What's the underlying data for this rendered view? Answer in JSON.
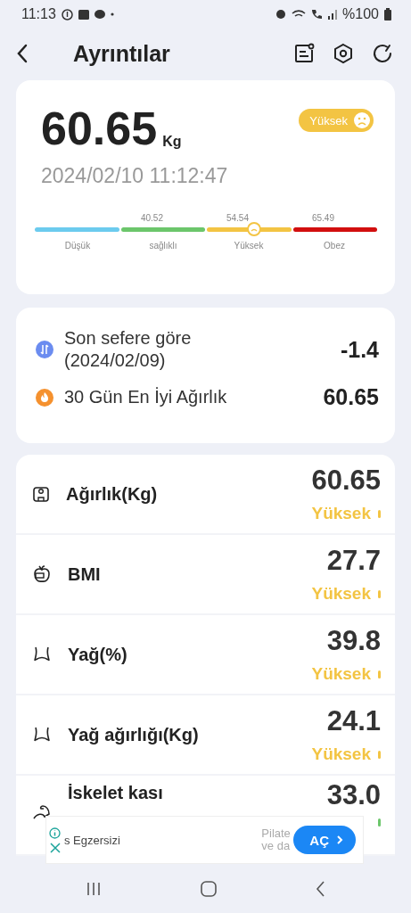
{
  "status_bar": {
    "time": "11:13",
    "battery": "%100"
  },
  "header": {
    "title": "Ayrıntılar"
  },
  "summary": {
    "weight": "60.65",
    "unit": "Kg",
    "badge": "Yüksek",
    "datetime": "2024/02/10 11:12:47",
    "gauge": {
      "level": 0.64,
      "thresholds": [
        "40.52",
        "54.54",
        "65.49"
      ],
      "segments": [
        {
          "label": "Düşük",
          "color": "#6ccbee"
        },
        {
          "label": "sağlıklı",
          "color": "#6cc66b"
        },
        {
          "label": "Yüksek",
          "color": "#f3c443"
        },
        {
          "label": "Obez",
          "color": "#d20f0f"
        }
      ]
    }
  },
  "comparison": [
    {
      "kind": "change",
      "label": "Son sefere göre\n(2024/02/09)",
      "value": "-1.4"
    },
    {
      "kind": "best",
      "label": "30 Gün En İyi Ağırlık",
      "value": "60.65"
    }
  ],
  "metrics": [
    {
      "kind": "scale",
      "name": "Ağırlık(Kg)",
      "value": "60.65",
      "status": "Yüksek",
      "color": "#f3c443"
    },
    {
      "kind": "apple",
      "name": "BMI",
      "value": "27.7",
      "status": "Yüksek",
      "color": "#f3c443"
    },
    {
      "kind": "body",
      "name": "Yağ(%)",
      "value": "39.8",
      "status": "Yüksek",
      "color": "#f3c443"
    },
    {
      "kind": "body",
      "name": "Yağ ağırlığı(Kg)",
      "value": "24.1",
      "status": "Yüksek",
      "color": "#f3c443"
    },
    {
      "kind": "muscle",
      "name": "İskelet kası",
      "value": "33.0",
      "color": "#6cc66b"
    }
  ],
  "ad": {
    "title": "s Egzersizi",
    "text": "Pilate\nve da",
    "button": "AÇ"
  }
}
